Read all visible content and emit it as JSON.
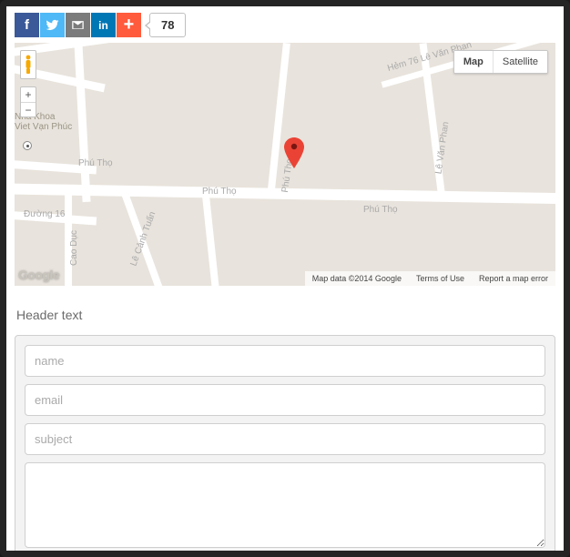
{
  "share": {
    "count": "78",
    "buttons": {
      "facebook": "f",
      "twitter": "",
      "email": "",
      "linkedin": "in",
      "addthis": "+"
    }
  },
  "map": {
    "type_options": {
      "map": "Map",
      "satellite": "Satellite"
    },
    "active_type": "map",
    "zoom": {
      "in": "+",
      "out": "−"
    },
    "roads": {
      "phu_tho": "Phú Thọ",
      "duong_16": "Đường 16",
      "cao_duc": "Cao Dục",
      "le_canh_tuan": "Lê Cảnh Tuấn",
      "phu_tho_hoa": "Phú Thọ Hòa",
      "le_van_phan": "Lê Văn Phan",
      "hem_76": "Hẻm 76 Lê Văn Phan",
      "poi": "Nha Khoa\nViet Vạn Phúc"
    },
    "logo": "Google",
    "footer": {
      "data": "Map data ©2014 Google",
      "terms": "Terms of Use",
      "report": "Report a map error"
    }
  },
  "form": {
    "header": "Header text",
    "placeholders": {
      "name": "name",
      "email": "email",
      "subject": "subject"
    }
  }
}
